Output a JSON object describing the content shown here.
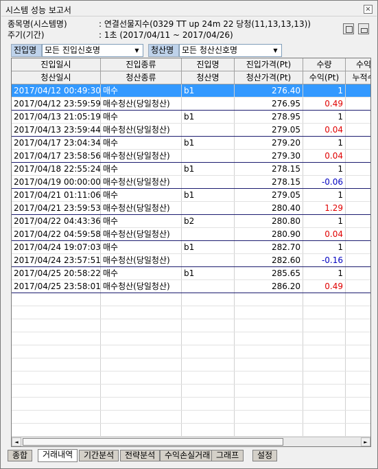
{
  "window": {
    "title": "시스템 성능 보고서",
    "close_label": "×"
  },
  "info": [
    {
      "key": "종목명(시스템명)",
      "value": ": 연결선물지수(0329 TT up 24m 22 당청(11,13,13,13))"
    },
    {
      "key": "주기(기간)",
      "value": ": 1초 (2017/04/11 ~ 2017/04/26)"
    }
  ],
  "filters": {
    "entry_label": "진입명",
    "entry_value": "모든 진입신호명",
    "exit_label": "청산명",
    "exit_value": "모든 청산신호명",
    "arrow": "▼"
  },
  "headers": {
    "row1": [
      "진입일시",
      "진입종류",
      "진입명",
      "진입가격(Pt)",
      "수량",
      "수익"
    ],
    "row2": [
      "청산일시",
      "청산종류",
      "청산명",
      "청산가격(Pt)",
      "수익(Pt)",
      "누적수"
    ]
  },
  "rows": [
    {
      "time": "2017/04/12 00:49:30",
      "type": "매수",
      "name": "b1",
      "price": "276.40",
      "val": "1",
      "cls": "",
      "sel": true
    },
    {
      "time": "2017/04/12 23:59:59",
      "type": "매수청산(당일청산)",
      "name": "",
      "price": "276.95",
      "val": "0.49",
      "cls": "red",
      "end": true
    },
    {
      "time": "2017/04/13 21:05:19",
      "type": "매수",
      "name": "b1",
      "price": "278.95",
      "val": "1",
      "cls": ""
    },
    {
      "time": "2017/04/13 23:59:44",
      "type": "매수청산(당일청산)",
      "name": "",
      "price": "279.05",
      "val": "0.04",
      "cls": "red",
      "end": true
    },
    {
      "time": "2017/04/17 23:04:34",
      "type": "매수",
      "name": "b1",
      "price": "279.20",
      "val": "1",
      "cls": ""
    },
    {
      "time": "2017/04/17 23:58:56",
      "type": "매수청산(당일청산)",
      "name": "",
      "price": "279.30",
      "val": "0.04",
      "cls": "red",
      "end": true
    },
    {
      "time": "2017/04/18 22:55:24",
      "type": "매수",
      "name": "b1",
      "price": "278.15",
      "val": "1",
      "cls": ""
    },
    {
      "time": "2017/04/19 00:00:00",
      "type": "매수청산(당일청산)",
      "name": "",
      "price": "278.15",
      "val": "-0.06",
      "cls": "blue",
      "end": true
    },
    {
      "time": "2017/04/21 01:11:06",
      "type": "매수",
      "name": "b1",
      "price": "279.05",
      "val": "1",
      "cls": ""
    },
    {
      "time": "2017/04/21 23:59:53",
      "type": "매수청산(당일청산)",
      "name": "",
      "price": "280.40",
      "val": "1.29",
      "cls": "red",
      "end": true
    },
    {
      "time": "2017/04/22 04:43:36",
      "type": "매수",
      "name": "b2",
      "price": "280.80",
      "val": "1",
      "cls": ""
    },
    {
      "time": "2017/04/22 04:59:58",
      "type": "매수청산(당일청산)",
      "name": "",
      "price": "280.90",
      "val": "0.04",
      "cls": "red",
      "end": true
    },
    {
      "time": "2017/04/24 19:07:03",
      "type": "매수",
      "name": "b1",
      "price": "282.70",
      "val": "1",
      "cls": ""
    },
    {
      "time": "2017/04/24 23:57:51",
      "type": "매수청산(당일청산)",
      "name": "",
      "price": "282.60",
      "val": "-0.16",
      "cls": "blue",
      "end": true
    },
    {
      "time": "2017/04/25 20:58:22",
      "type": "매수",
      "name": "b1",
      "price": "285.65",
      "val": "1",
      "cls": ""
    },
    {
      "time": "2017/04/25 23:58:01",
      "type": "매수청산(당일청산)",
      "name": "",
      "price": "286.20",
      "val": "0.49",
      "cls": "red",
      "end": true
    }
  ],
  "scroll": {
    "left": "◄",
    "right": "►"
  },
  "tabs": [
    "종합",
    "거래내역",
    "기간분석",
    "전략분석",
    "수익손실거래",
    "그래프",
    "설정"
  ],
  "active_tab": "거래내역",
  "colors": {
    "selection": "#3399ff",
    "profit": "#e00000",
    "loss": "#0000c0"
  }
}
